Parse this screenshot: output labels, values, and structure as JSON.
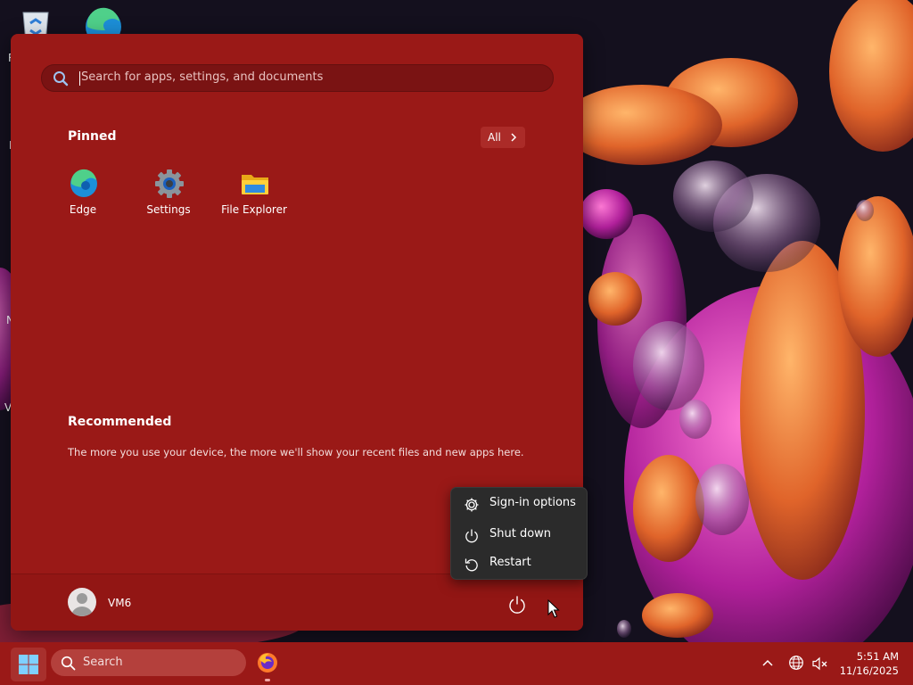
{
  "desktop": {
    "icons": [
      "recycle-bin-icon",
      "edge-icon"
    ],
    "edge_letters": [
      "R",
      "I",
      "N",
      "V"
    ]
  },
  "start_menu": {
    "search": {
      "placeholder": "Search for apps, settings, and documents",
      "icon": "search-icon"
    },
    "pinned": {
      "title": "Pinned",
      "all_label": "All",
      "apps": [
        {
          "label": "Edge",
          "icon": "edge-icon"
        },
        {
          "label": "Settings",
          "icon": "settings-gear-icon"
        },
        {
          "label": "File Explorer",
          "icon": "folder-icon"
        }
      ]
    },
    "recommended": {
      "title": "Recommended",
      "text": "The more you use your device, the more we'll show your recent files and new apps here."
    },
    "user": {
      "name": "VM6",
      "avatar_icon": "user-avatar-icon"
    },
    "power_menu": [
      {
        "label": "Sign-in options",
        "icon": "gear-icon"
      },
      {
        "label": "Shut down",
        "icon": "power-icon"
      },
      {
        "label": "Restart",
        "icon": "restart-icon"
      }
    ]
  },
  "taskbar": {
    "search_label": "Search",
    "apps": [
      "firefox-icon"
    ],
    "tray": [
      "chevron-up-icon",
      "globe-icon",
      "volume-muted-icon"
    ],
    "clock": {
      "time": "5:51 AM",
      "date": "11/16/2025"
    }
  },
  "colors": {
    "accent": "#9a1917",
    "menu": "#2b2b2b"
  }
}
